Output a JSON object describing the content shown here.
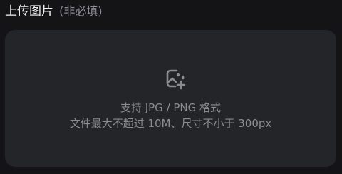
{
  "upload": {
    "title": "上传图片",
    "optional_note": "(非必填)",
    "icon": "add-image-icon",
    "format_hint": "支持 JPG / PNG 格式",
    "size_hint": "文件最大不超过 10M、尺寸不小于 300px"
  },
  "colors": {
    "page_background": "#141416",
    "zone_background": "#242529",
    "title_text": "#f2f2f4",
    "muted_text": "#8b8c91"
  }
}
